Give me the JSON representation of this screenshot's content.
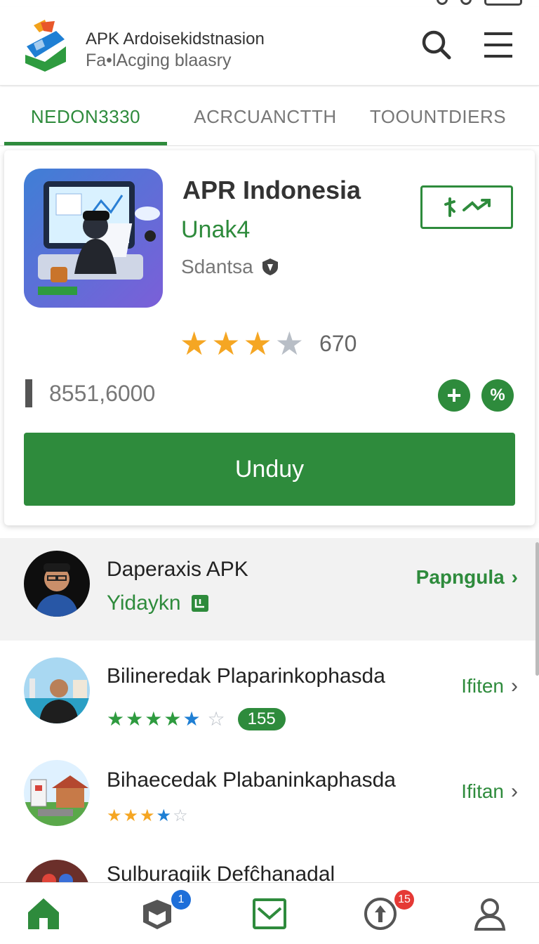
{
  "header": {
    "title": "APK Ardoisekidstnasion",
    "subtitle": "Fa•lAcging blaasry",
    "icons": [
      "search-icon",
      "menu-icon"
    ]
  },
  "tabs": [
    {
      "label": "NEDON3330",
      "active": true
    },
    {
      "label": "ACRCUANCTTH",
      "active": false
    },
    {
      "label": "TOOUNTDIERS",
      "active": false
    }
  ],
  "featured": {
    "name": "APR Indonesia",
    "developer": "Unak4",
    "category": "Sdantsa",
    "rating": {
      "value": 3,
      "max": 4,
      "count": "670"
    },
    "downloads": "8551,6000",
    "download_label": "Unduy",
    "pct_label": "%"
  },
  "list": [
    {
      "title": "Daperaxis APK",
      "subtitle": "Yidaykn",
      "action": "Papngula",
      "chevron": "›"
    },
    {
      "title": "Bilineredak Plaparinkophasda",
      "rating": 5,
      "badge": "155",
      "action": "Ifiten",
      "chevron": "›"
    },
    {
      "title": "Bihaecedak Plabaninkaphasda",
      "rating": 4,
      "action": "Ifitan",
      "chevron": "›"
    },
    {
      "title": "Sulburagiik Defĉhanadal"
    }
  ],
  "bottom_nav": [
    {
      "icon": "home-icon",
      "active": true
    },
    {
      "icon": "box-icon",
      "badge": "1"
    },
    {
      "icon": "mail-icon"
    },
    {
      "icon": "upload-icon",
      "badge": "15"
    },
    {
      "icon": "profile-icon"
    }
  ],
  "colors": {
    "accent": "#2e8b3c",
    "star": "#f5a623",
    "star_empty": "#b8bec6",
    "badge_blue": "#1e6fd9",
    "badge_red": "#e53935"
  }
}
